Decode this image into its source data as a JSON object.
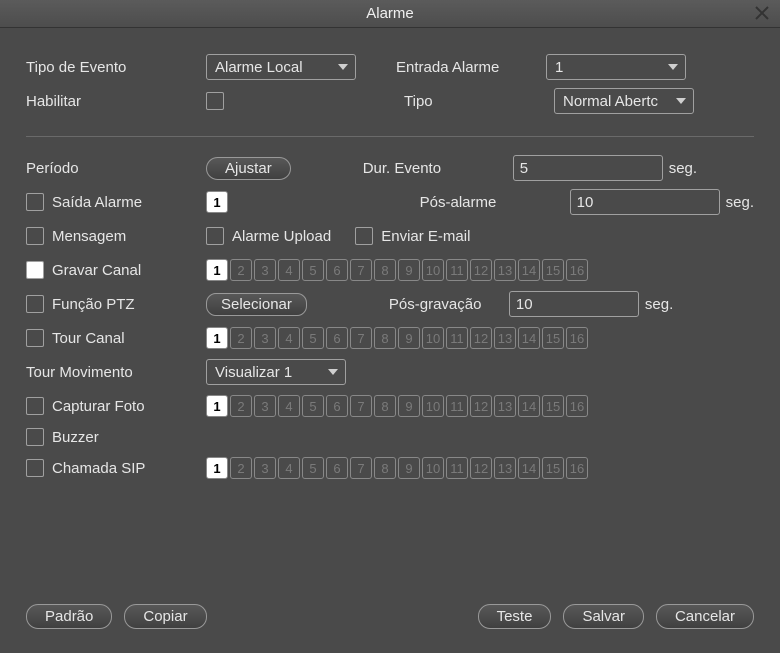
{
  "window": {
    "title": "Alarme"
  },
  "labels": {
    "tipo_evento": "Tipo de Evento",
    "habilitar": "Habilitar",
    "entrada_alarme": "Entrada Alarme",
    "tipo": "Tipo",
    "periodo": "Período",
    "dur_evento": "Dur. Evento",
    "pos_alarme": "Pós-alarme",
    "pos_gravacao": "Pós-gravação",
    "saida_alarme": "Saída Alarme",
    "mensagem": "Mensagem",
    "alarme_upload": "Alarme Upload",
    "enviar_email": "Enviar E-mail",
    "gravar_canal": "Gravar Canal",
    "funcao_ptz": "Função PTZ",
    "tour_canal": "Tour Canal",
    "tour_movimento": "Tour Movimento",
    "capturar_foto": "Capturar Foto",
    "buzzer": "Buzzer",
    "chamada_sip": "Chamada SIP",
    "seg": "seg."
  },
  "buttons": {
    "ajustar": "Ajustar",
    "selecionar": "Selecionar",
    "padrao": "Padrão",
    "copiar": "Copiar",
    "teste": "Teste",
    "salvar": "Salvar",
    "cancelar": "Cancelar"
  },
  "selects": {
    "tipo_evento": "Alarme Local",
    "entrada_alarme": "1",
    "tipo": "Normal Abertc",
    "tour_movimento": "Visualizar 1"
  },
  "inputs": {
    "dur_evento": "5",
    "pos_alarme": "10",
    "pos_gravacao": "10"
  },
  "checks": {
    "habilitar": false,
    "saida_alarme": false,
    "mensagem": false,
    "alarme_upload": false,
    "enviar_email": false,
    "gravar_canal": true,
    "funcao_ptz": false,
    "tour_canal": false,
    "capturar_foto": false,
    "buzzer": false,
    "chamada_sip": false
  },
  "channels": {
    "saida_alarme": {
      "count": 1,
      "selected": [
        1
      ]
    },
    "gravar_canal": {
      "count": 16,
      "selected": [
        1
      ]
    },
    "tour_canal": {
      "count": 16,
      "selected": [
        1
      ]
    },
    "capturar_foto": {
      "count": 16,
      "selected": [
        1
      ]
    },
    "chamada_sip": {
      "count": 16,
      "selected": [
        1
      ]
    }
  }
}
